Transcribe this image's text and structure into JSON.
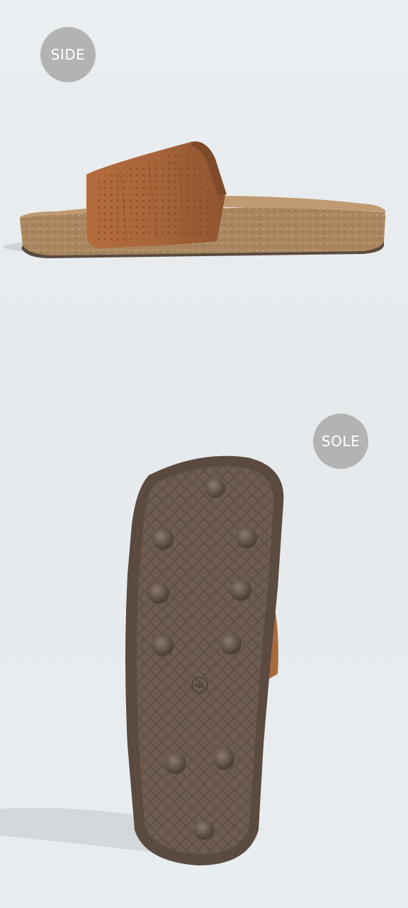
{
  "labels": {
    "side": "SIDE",
    "sole": "SOLE"
  },
  "sole_size_mark": "9",
  "colors": {
    "badge": "#b3b3b3",
    "strap": "#a8673a",
    "footbed": "#b58a62",
    "cork": "#a88560",
    "outsole": "#66554a"
  }
}
